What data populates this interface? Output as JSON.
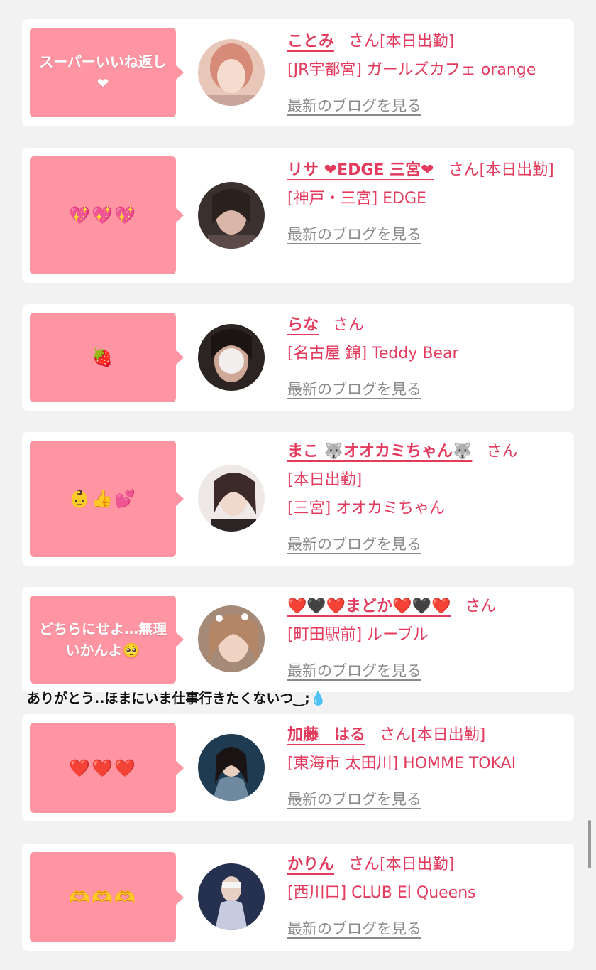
{
  "cards": [
    {
      "bubble": "スーパーいいね返し❤",
      "name": "ことみ",
      "san": "さん",
      "tag": "[本日出勤]",
      "shop": "[JR宇都宮] ガールズカフェ orange",
      "blog": "最新のブログを見る"
    },
    {
      "bubble": "💖💖💖",
      "name": "リサ ❤EDGE 三宮❤",
      "san": "さん",
      "tag": "[本日出勤]",
      "shop": "[神戸・三宮] EDGE",
      "blog": "最新のブログを見る"
    },
    {
      "bubble": "🍓",
      "name": "らな",
      "san": "さん",
      "tag": "",
      "shop": "[名古屋 錦] Teddy Bear",
      "blog": "最新のブログを見る"
    },
    {
      "bubble": "👶👍💕",
      "name": "まこ 🐺オオカミちゃん🐺",
      "san": "さん",
      "tag": "[本日出勤]",
      "shop": "[三宮] オオカミちゃん",
      "blog": "最新のブログを見る"
    },
    {
      "bubble": "どちらにせよ…無理いかんよ🥺",
      "name": "❤️🖤❤️まどか❤️🖤❤️",
      "san": "さん",
      "tag": "",
      "shop": "[町田駅前] ルーブル",
      "blog": "最新のブログを見る"
    },
    {
      "bubble": "❤️❤️❤️",
      "name": "加藤　はる",
      "san": "さん",
      "tag": "[本日出勤]",
      "shop": "[東海市 太田川] HOMME TOKAI",
      "blog": "最新のブログを見る"
    },
    {
      "bubble": "🫶🫶🫶",
      "name": "かりん",
      "san": "さん",
      "tag": "[本日出勤]",
      "shop": "[西川口] CLUB El Queens",
      "blog": "最新のブログを見る"
    }
  ],
  "overlay_caption": "ありがとう..ほまにいま仕事行きたくないつ‿;💧",
  "colors": {
    "accent": "#e33b5e",
    "bubble": "#ff95a3",
    "link_gray": "#8a8a8a",
    "background": "#f2f2f2"
  }
}
